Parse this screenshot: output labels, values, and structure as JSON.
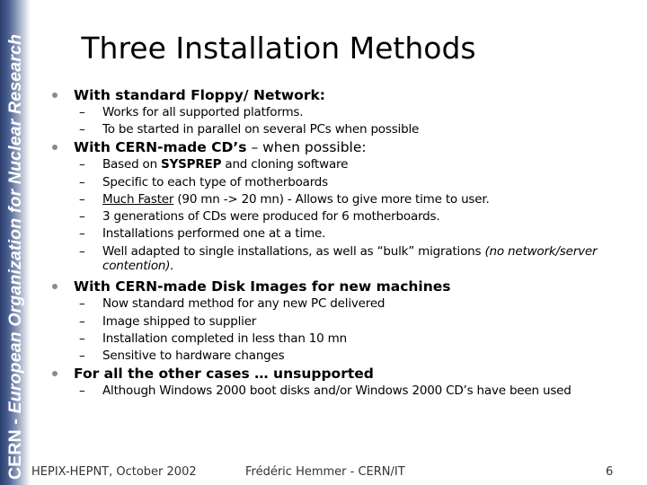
{
  "sidebar": {
    "text_bold": "CERN - ",
    "text_italic": "European Organization for Nuclear Research",
    "gradient_colors": [
      "#2a3f6f",
      "#a7b2c8",
      "#ffffff"
    ]
  },
  "title": "Three Installation Methods",
  "bullets": [
    {
      "label": "With standard Floppy/ Network:",
      "suffix": "",
      "subitems": [
        {
          "text": "Works for all supported platforms."
        },
        {
          "text": "To be started in parallel on several PCs when possible"
        }
      ]
    },
    {
      "label": "With CERN-made CD’s",
      "suffix": " – when possible:",
      "subitems": [
        {
          "pre": "Based on ",
          "bold": "SYSPREP",
          "post": " and cloning software"
        },
        {
          "text": "Specific to each type of motherboards"
        },
        {
          "underline": "Much Faster",
          "post": " (90 mn -> 20 mn) - Allows to give more time to user."
        },
        {
          "text": "3 generations of CDs were produced for 6 motherboards."
        },
        {
          "text": "Installations performed one at a time."
        },
        {
          "pre": "Well adapted to single installations, as well as “bulk” migrations ",
          "italic": "(no network/server contention)."
        }
      ]
    },
    {
      "label": "With CERN-made Disk Images for new machines",
      "suffix": "",
      "subitems": [
        {
          "text": "Now standard method for any new PC delivered"
        },
        {
          "text": "Image shipped to supplier"
        },
        {
          "text": "Installation completed in less than 10 mn"
        },
        {
          "text": "Sensitive to hardware changes"
        }
      ]
    },
    {
      "label": "For all the other cases … unsupported",
      "suffix": "",
      "subitems": [
        {
          "text": "Although Windows 2000 boot disks and/or Windows 2000 CD’s have been used"
        }
      ]
    }
  ],
  "dash": "–",
  "footer": {
    "left": "HEPIX-HEPNT, October 2002",
    "center": "Frédéric Hemmer - CERN/IT",
    "page_number": "6"
  }
}
